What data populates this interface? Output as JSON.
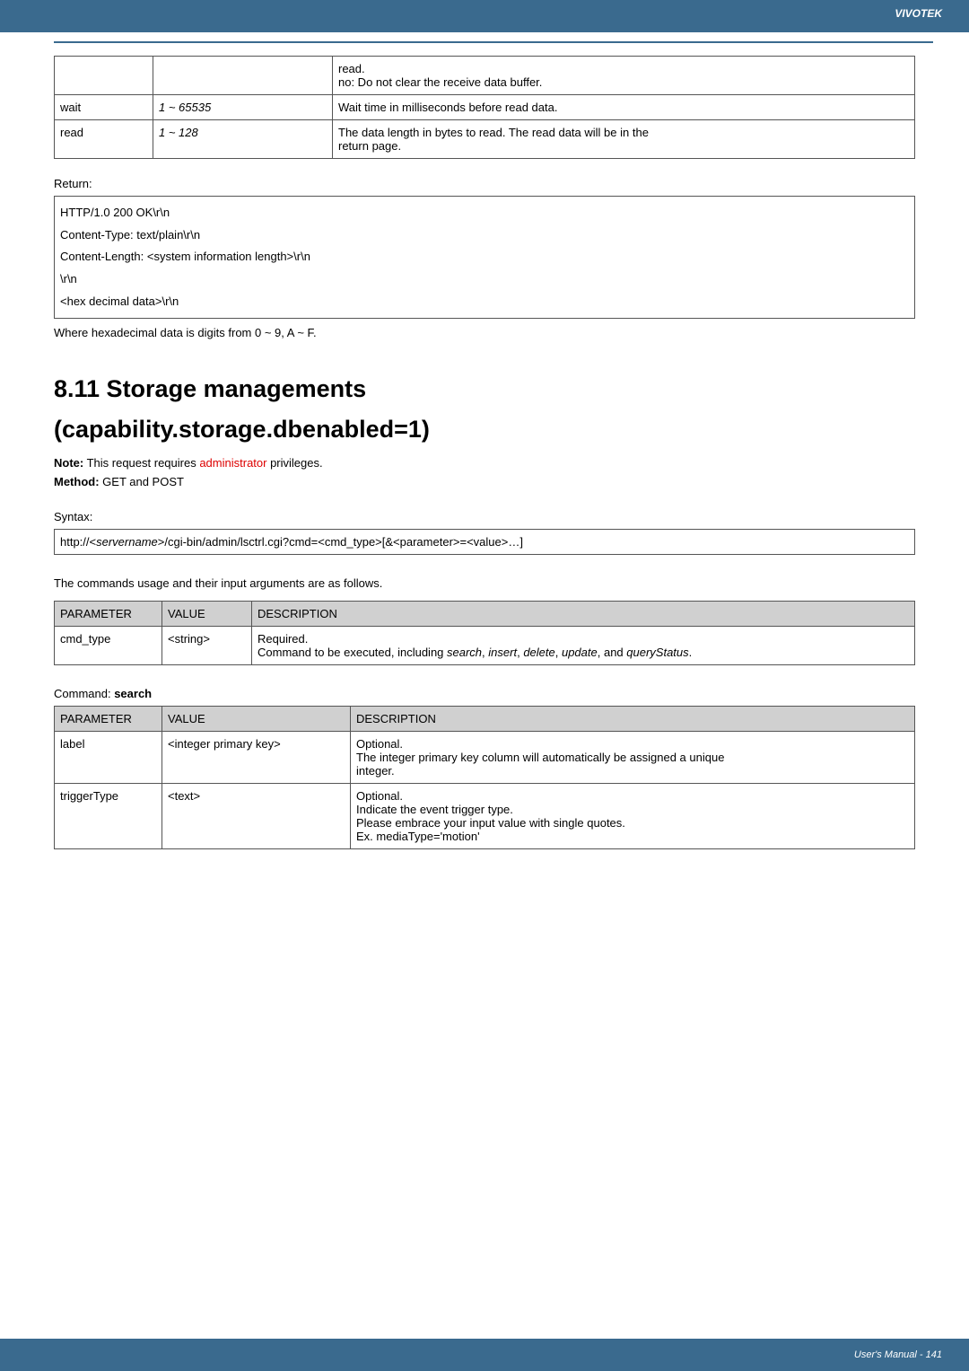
{
  "header": {
    "brand": "VIVOTEK"
  },
  "top_table": {
    "r0c2a": "read.",
    "r0c2b": "no: Do not clear the receive data buffer.",
    "r1c0": "wait",
    "r1c1": "1 ~ 65535",
    "r1c2": "Wait time in milliseconds before read data.",
    "r2c0": "read",
    "r2c1": "1 ~ 128",
    "r2c2a": "The data length in bytes to read. The read data will be in the",
    "r2c2b": "return page."
  },
  "return": {
    "label": "Return:",
    "l1": "HTTP/1.0 200 OK\\r\\n",
    "l2": "Content-Type: text/plain\\r\\n",
    "l3": "Content-Length: <system information length>\\r\\n",
    "l4": "\\r\\n",
    "l5": "<hex decimal data>\\r\\n"
  },
  "hex_note": "Where hexadecimal data is digits from 0 ~ 9, A ~ F.",
  "heading1": "8.11 Storage managements",
  "heading2": "(capability.storage.dbenabled=1)",
  "note_prefix": "Note:",
  "note_text1": " This request requires ",
  "note_admin": "administrator",
  "note_text2": " privileges.",
  "method_prefix": "Method:",
  "method_text": " GET and POST",
  "syntax_label": "Syntax:",
  "syntax_line_a": "http://<",
  "syntax_server": "servername",
  "syntax_line_b": ">/cgi-bin/admin/lsctrl.cgi?cmd=<cmd_type>[&<parameter>=<value>…]",
  "usage_line": "The commands usage and their input arguments are as follows.",
  "param_table1": {
    "h0": "PARAMETER",
    "h1": "VALUE",
    "h2": "DESCRIPTION",
    "r0c0": "cmd_type",
    "r0c1": "<string>",
    "r0c2a": "Required.",
    "r0c2b_a": "Command to be executed, including ",
    "s_search": "search",
    "s_insert": "insert",
    "s_delete": "delete",
    "s_update": "update",
    "s_query": "queryStatus",
    "r0c2b_comma": ", ",
    "r0c2b_and": ", and ",
    "r0c2b_end": "."
  },
  "command_label_prefix": "Command: ",
  "command_label": "search",
  "param_table2": {
    "h0": "PARAMETER",
    "h1": "VALUE",
    "h2": "DESCRIPTION",
    "r0c0": "label",
    "r0c1": "<integer primary key>",
    "r0c2a": "Optional.",
    "r0c2b": "The integer primary key column will automatically be assigned a unique",
    "r0c2c": "integer.",
    "r1c0": "triggerType",
    "r1c1": "<text>",
    "r1c2a": "Optional.",
    "r1c2b": "Indicate the event trigger type.",
    "r1c2c": "Please embrace your input value with single quotes.",
    "r1c2d": "Ex. mediaType='motion'"
  },
  "footer": {
    "text": "User's Manual - 141"
  }
}
